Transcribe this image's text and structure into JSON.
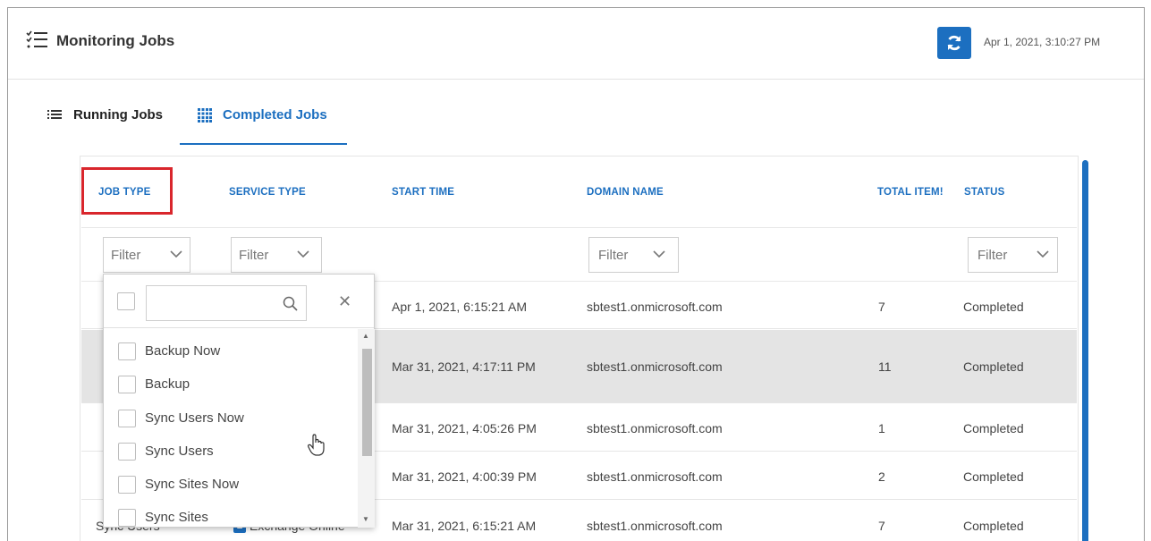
{
  "app": {
    "title": "Monitoring Jobs",
    "timestamp": "Apr 1, 2021, 3:10:27 PM"
  },
  "tabs": [
    {
      "label": "Running Jobs",
      "icon": "list-icon",
      "active": false
    },
    {
      "label": "Completed Jobs",
      "icon": "grid-icon",
      "active": true
    }
  ],
  "table": {
    "headers": {
      "job_type": "JOB TYPE",
      "service_type": "SERVICE TYPE",
      "start_time": "START TIME",
      "domain_name": "DOMAIN NAME",
      "total_items": "TOTAL ITEM!",
      "status": "STATUS"
    },
    "filters": {
      "job_type": "Filter",
      "service_type": "Filter",
      "domain_name": "Filter",
      "status": "Filter"
    },
    "rows": [
      {
        "job_type": "",
        "service_type": "",
        "start_time": "Apr 1, 2021, 6:15:21 AM",
        "domain_name": "sbtest1.onmicrosoft.com",
        "total_items": "7",
        "status": "Completed"
      },
      {
        "job_type": "",
        "service_type": "",
        "start_time": "Mar 31, 2021, 4:17:11 PM",
        "domain_name": "sbtest1.onmicrosoft.com",
        "total_items": "11",
        "status": "Completed"
      },
      {
        "job_type": "",
        "service_type": "",
        "start_time": "Mar 31, 2021, 4:05:26 PM",
        "domain_name": "sbtest1.onmicrosoft.com",
        "total_items": "1",
        "status": "Completed"
      },
      {
        "job_type": "",
        "service_type": "",
        "start_time": "Mar 31, 2021, 4:00:39 PM",
        "domain_name": "sbtest1.onmicrosoft.com",
        "total_items": "2",
        "status": "Completed"
      },
      {
        "job_type": "Sync Users",
        "service_type": "Exchange Online",
        "start_time": "Mar 31, 2021, 6:15:21 AM",
        "domain_name": "sbtest1.onmicrosoft.com",
        "total_items": "7",
        "status": "Completed"
      }
    ]
  },
  "dropdown": {
    "search_value": "",
    "items": [
      "Backup Now",
      "Backup",
      "Sync Users Now",
      "Sync Users",
      "Sync Sites Now",
      "Sync Sites"
    ]
  },
  "colors": {
    "accent": "#1c6fc0",
    "highlight": "#d9262c",
    "selected_row": "#e4e4e4"
  }
}
